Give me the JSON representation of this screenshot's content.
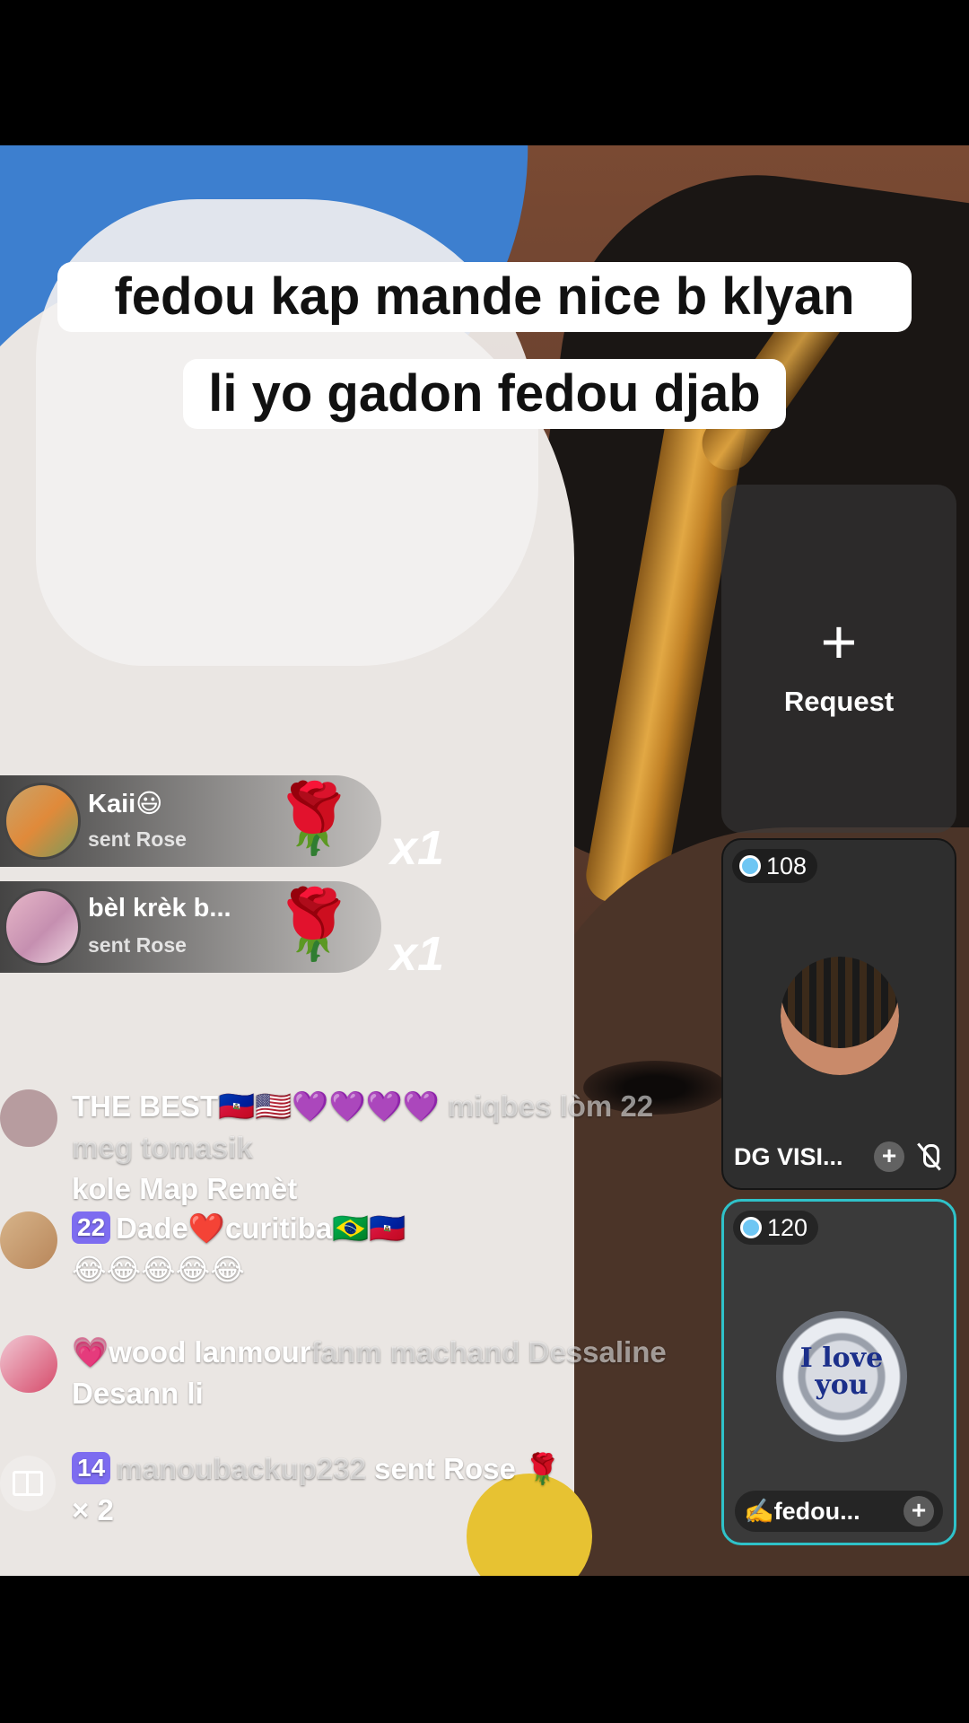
{
  "caption": {
    "line1": "fedou  kap mande nice b klyan",
    "line2": "li yo gadon fedou djab"
  },
  "request": {
    "plus": "+",
    "label": "Request"
  },
  "guests": [
    {
      "score": "108",
      "name": "DG VISI...",
      "plus": "+",
      "muted": true
    },
    {
      "score": "120",
      "name": "✍️fedou...",
      "plus": "+",
      "avatar_text": "I love you",
      "highlight_color": "#2fc2c9"
    }
  ],
  "gifts": [
    {
      "user": "Kaii😃",
      "action": "sent Rose",
      "icon": "🌹",
      "count": "x1"
    },
    {
      "user": "bèl krèk  b...",
      "action": "sent Rose",
      "icon": "🌹",
      "count": "x1"
    }
  ],
  "chat": [
    {
      "line1": "THE BEST🇭🇹🇺🇸💜💜💜💜",
      "line1_faded": "miqbes lòm 22 meg tomasik",
      "line2": "kole Map Remèt"
    },
    {
      "badge": "22",
      "line1": "Dade❤️curitiba🇧🇷🇭🇹",
      "line2": "😂😂😂😂😂"
    },
    {
      "line1": "💗wood lanmour",
      "line1_faded": "fanm machand Dessaline",
      "line2": "Desann li"
    },
    {
      "badge": "14",
      "user": "manoubackup232",
      "text": "sent Rose 🌹",
      "line2": "× 2"
    }
  ]
}
